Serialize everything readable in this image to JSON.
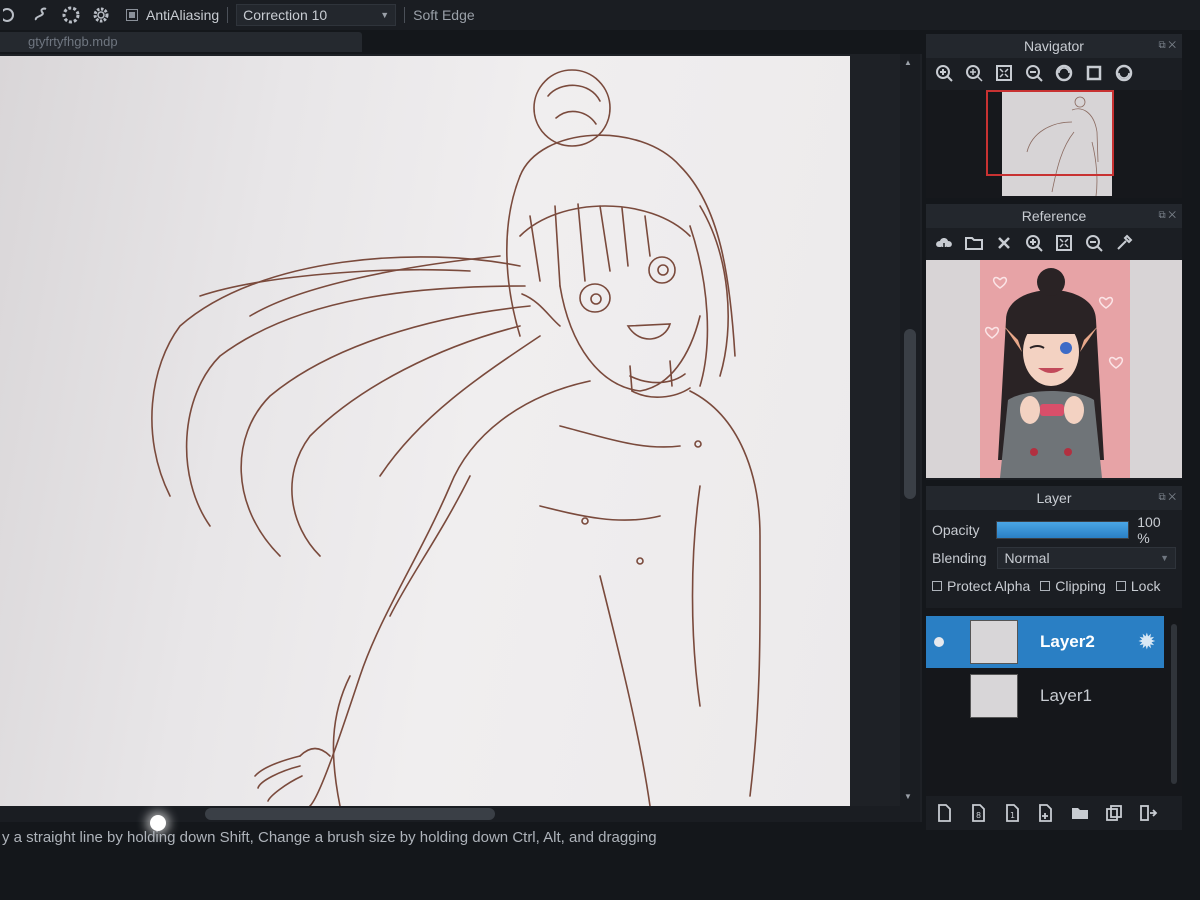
{
  "toolbar": {
    "antialiasing_label": "AntiAliasing",
    "correction_label": "Correction",
    "correction_value": "10",
    "soft_edge_label": "Soft Edge"
  },
  "document": {
    "tab_title": "gtyfrtyfhgb.mdp"
  },
  "status_bar": {
    "hint": "y a straight line by holding down Shift, Change a brush size by holding down Ctrl, Alt, and dragging"
  },
  "navigator": {
    "title": "Navigator",
    "icons": [
      "zoom-in-icon",
      "zoom-in-small-icon",
      "fit-icon",
      "zoom-out-icon",
      "rotate-left-icon",
      "fullscreen-icon",
      "rotate-right-icon"
    ]
  },
  "reference": {
    "title": "Reference",
    "icons": [
      "cloud-icon",
      "folder-open-icon",
      "close-icon",
      "zoom-in-icon",
      "fit-icon",
      "zoom-out-icon",
      "eyedropper-icon"
    ]
  },
  "layer_panel": {
    "title": "Layer",
    "opacity_label": "Opacity",
    "opacity_value": "100 %",
    "opacity_fraction": 1.0,
    "blending_label": "Blending",
    "blending_value": "Normal",
    "protect_alpha_label": "Protect Alpha",
    "clipping_label": "Clipping",
    "lock_label": "Lock",
    "layers": [
      {
        "name": "Layer2",
        "active": true,
        "visible": true
      },
      {
        "name": "Layer1",
        "active": false,
        "visible": false
      }
    ]
  },
  "colors": {
    "accent": "#2a7fc4",
    "navigator_frame": "#c83232",
    "sketch_line": "#7a4a3c"
  }
}
